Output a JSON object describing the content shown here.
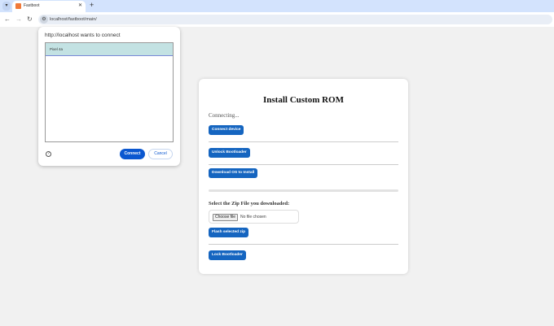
{
  "browser": {
    "tab_title": "Fastboot",
    "url": "localhost/fastboot/main/"
  },
  "popup": {
    "title": "http://localhost wants to connect",
    "devices": [
      "Pixel 4a"
    ],
    "connect_label": "Connect",
    "cancel_label": "Cancel"
  },
  "main": {
    "title": "Install Custom ROM",
    "status": "Connecting...",
    "connect_device": "Connect device",
    "unlock": "Unlock Bootloader",
    "download": "Download OS to Install",
    "download_progress": 0,
    "zip_label": "Select the Zip File you downloaded:",
    "choose_file": "Choose file",
    "no_file": "No file chosen",
    "flash": "Flash selected zip",
    "lock": "Lock Bootloader"
  },
  "colors": {
    "button": "#1565c0",
    "popup_accent": "#0b57d0",
    "selected_item": "#c3e2e3"
  }
}
